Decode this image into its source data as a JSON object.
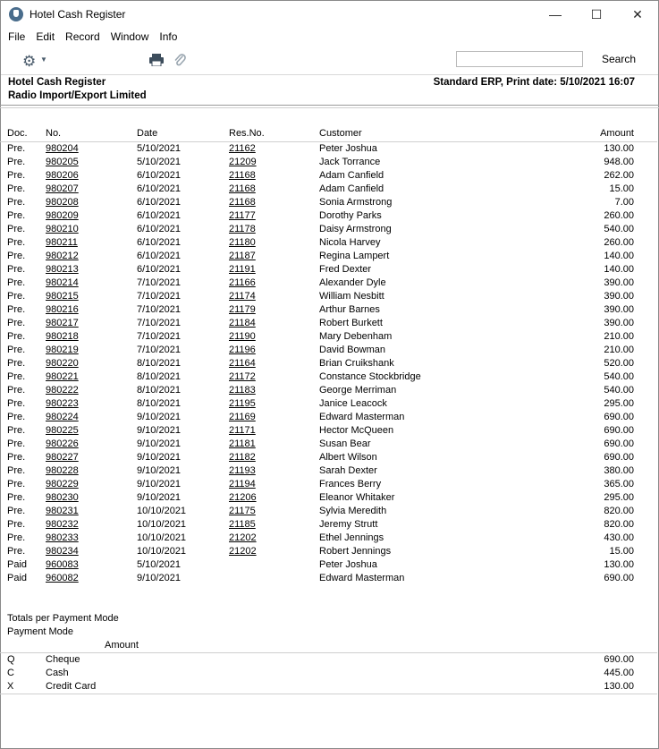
{
  "window": {
    "title": "Hotel Cash Register",
    "minimize": "—",
    "maximize": "☐",
    "close": "✕"
  },
  "menu": [
    "File",
    "Edit",
    "Record",
    "Window",
    "Info"
  ],
  "toolbar": {
    "search_value": "",
    "search_label": "Search"
  },
  "report": {
    "title": "Hotel Cash Register",
    "company": "Radio Import/Export Limited",
    "meta": "Standard ERP, Print date: 5/10/2021 16:07"
  },
  "columns": {
    "doc": "Doc.",
    "no": "No.",
    "date": "Date",
    "res": "Res.No.",
    "customer": "Customer",
    "amount": "Amount"
  },
  "rows": [
    {
      "doc": "Pre.",
      "no": "980204",
      "date": "5/10/2021",
      "res": "21162",
      "customer": "Peter Joshua",
      "amount": "130.00"
    },
    {
      "doc": "Pre.",
      "no": "980205",
      "date": "5/10/2021",
      "res": "21209",
      "customer": "Jack Torrance",
      "amount": "948.00"
    },
    {
      "doc": "Pre.",
      "no": "980206",
      "date": "6/10/2021",
      "res": "21168",
      "customer": "Adam Canfield",
      "amount": "262.00"
    },
    {
      "doc": "Pre.",
      "no": "980207",
      "date": "6/10/2021",
      "res": "21168",
      "customer": "Adam Canfield",
      "amount": "15.00"
    },
    {
      "doc": "Pre.",
      "no": "980208",
      "date": "6/10/2021",
      "res": "21168",
      "customer": "Sonia Armstrong",
      "amount": "7.00"
    },
    {
      "doc": "Pre.",
      "no": "980209",
      "date": "6/10/2021",
      "res": "21177",
      "customer": "Dorothy Parks",
      "amount": "260.00"
    },
    {
      "doc": "Pre.",
      "no": "980210",
      "date": "6/10/2021",
      "res": "21178",
      "customer": "Daisy Armstrong",
      "amount": "540.00"
    },
    {
      "doc": "Pre.",
      "no": "980211",
      "date": "6/10/2021",
      "res": "21180",
      "customer": "Nicola Harvey",
      "amount": "260.00"
    },
    {
      "doc": "Pre.",
      "no": "980212",
      "date": "6/10/2021",
      "res": "21187",
      "customer": "Regina Lampert",
      "amount": "140.00"
    },
    {
      "doc": "Pre.",
      "no": "980213",
      "date": "6/10/2021",
      "res": "21191",
      "customer": "Fred Dexter",
      "amount": "140.00"
    },
    {
      "doc": "Pre.",
      "no": "980214",
      "date": "7/10/2021",
      "res": "21166",
      "customer": "Alexander Dyle",
      "amount": "390.00"
    },
    {
      "doc": "Pre.",
      "no": "980215",
      "date": "7/10/2021",
      "res": "21174",
      "customer": "William Nesbitt",
      "amount": "390.00"
    },
    {
      "doc": "Pre.",
      "no": "980216",
      "date": "7/10/2021",
      "res": "21179",
      "customer": "Arthur Barnes",
      "amount": "390.00"
    },
    {
      "doc": "Pre.",
      "no": "980217",
      "date": "7/10/2021",
      "res": "21184",
      "customer": "Robert Burkett",
      "amount": "390.00"
    },
    {
      "doc": "Pre.",
      "no": "980218",
      "date": "7/10/2021",
      "res": "21190",
      "customer": "Mary Debenham",
      "amount": "210.00"
    },
    {
      "doc": "Pre.",
      "no": "980219",
      "date": "7/10/2021",
      "res": "21196",
      "customer": "David Bowman",
      "amount": "210.00"
    },
    {
      "doc": "Pre.",
      "no": "980220",
      "date": "8/10/2021",
      "res": "21164",
      "customer": "Brian Cruikshank",
      "amount": "520.00"
    },
    {
      "doc": "Pre.",
      "no": "980221",
      "date": "8/10/2021",
      "res": "21172",
      "customer": "Constance Stockbridge",
      "amount": "540.00"
    },
    {
      "doc": "Pre.",
      "no": "980222",
      "date": "8/10/2021",
      "res": "21183",
      "customer": "George Merriman",
      "amount": "540.00"
    },
    {
      "doc": "Pre.",
      "no": "980223",
      "date": "8/10/2021",
      "res": "21195",
      "customer": "Janice Leacock",
      "amount": "295.00"
    },
    {
      "doc": "Pre.",
      "no": "980224",
      "date": "9/10/2021",
      "res": "21169",
      "customer": "Edward Masterman",
      "amount": "690.00"
    },
    {
      "doc": "Pre.",
      "no": "980225",
      "date": "9/10/2021",
      "res": "21171",
      "customer": "Hector McQueen",
      "amount": "690.00"
    },
    {
      "doc": "Pre.",
      "no": "980226",
      "date": "9/10/2021",
      "res": "21181",
      "customer": "Susan Bear",
      "amount": "690.00"
    },
    {
      "doc": "Pre.",
      "no": "980227",
      "date": "9/10/2021",
      "res": "21182",
      "customer": "Albert Wilson",
      "amount": "690.00"
    },
    {
      "doc": "Pre.",
      "no": "980228",
      "date": "9/10/2021",
      "res": "21193",
      "customer": "Sarah Dexter",
      "amount": "380.00"
    },
    {
      "doc": "Pre.",
      "no": "980229",
      "date": "9/10/2021",
      "res": "21194",
      "customer": "Frances Berry",
      "amount": "365.00"
    },
    {
      "doc": "Pre.",
      "no": "980230",
      "date": "9/10/2021",
      "res": "21206",
      "customer": "Eleanor Whitaker",
      "amount": "295.00"
    },
    {
      "doc": "Pre.",
      "no": "980231",
      "date": "10/10/2021",
      "res": "21175",
      "customer": "Sylvia Meredith",
      "amount": "820.00"
    },
    {
      "doc": "Pre.",
      "no": "980232",
      "date": "10/10/2021",
      "res": "21185",
      "customer": "Jeremy Strutt",
      "amount": "820.00"
    },
    {
      "doc": "Pre.",
      "no": "980233",
      "date": "10/10/2021",
      "res": "21202",
      "customer": "Ethel Jennings",
      "amount": "430.00"
    },
    {
      "doc": "Pre.",
      "no": "980234",
      "date": "10/10/2021",
      "res": "21202",
      "customer": "Robert Jennings",
      "amount": "15.00"
    },
    {
      "doc": "Paid",
      "no": "960083",
      "date": "5/10/2021",
      "res": "",
      "customer": "Peter Joshua",
      "amount": "130.00"
    },
    {
      "doc": "Paid",
      "no": "960082",
      "date": "9/10/2021",
      "res": "",
      "customer": "Edward Masterman",
      "amount": "690.00"
    }
  ],
  "totals": {
    "title": "Totals per Payment Mode",
    "mode_label": "Payment Mode",
    "amount_label": "Amount",
    "modes": [
      {
        "code": "Q",
        "name": "Cheque",
        "amount": "690.00"
      },
      {
        "code": "C",
        "name": "Cash",
        "amount": "445.00"
      },
      {
        "code": "X",
        "name": "Credit Card",
        "amount": "130.00"
      }
    ]
  }
}
